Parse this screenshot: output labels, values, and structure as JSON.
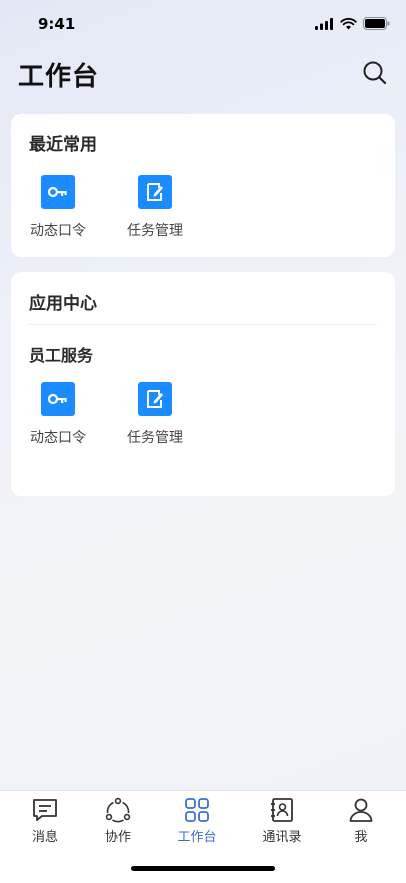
{
  "status_bar": {
    "time": "9:41"
  },
  "header": {
    "title": "工作台",
    "search_icon": "search-icon"
  },
  "recent": {
    "title": "最近常用",
    "apps": [
      {
        "label": "动态口令",
        "icon": "key-icon",
        "color": "#1a8cff"
      },
      {
        "label": "任务管理",
        "icon": "task-edit-icon",
        "color": "#1a8cff"
      }
    ]
  },
  "app_center": {
    "title": "应用中心",
    "group_title": "员工服务",
    "apps": [
      {
        "label": "动态口令",
        "icon": "key-icon",
        "color": "#1a8cff"
      },
      {
        "label": "任务管理",
        "icon": "task-edit-icon",
        "color": "#1a8cff"
      }
    ]
  },
  "tabbar": {
    "active_color": "#3b6fd4",
    "items": [
      {
        "label": "消息",
        "icon": "message-icon",
        "active": false
      },
      {
        "label": "协作",
        "icon": "collaboration-icon",
        "active": false
      },
      {
        "label": "工作台",
        "icon": "workbench-grid-icon",
        "active": true
      },
      {
        "label": "通讯录",
        "icon": "contacts-icon",
        "active": false
      },
      {
        "label": "我",
        "icon": "profile-icon",
        "active": false
      }
    ]
  }
}
